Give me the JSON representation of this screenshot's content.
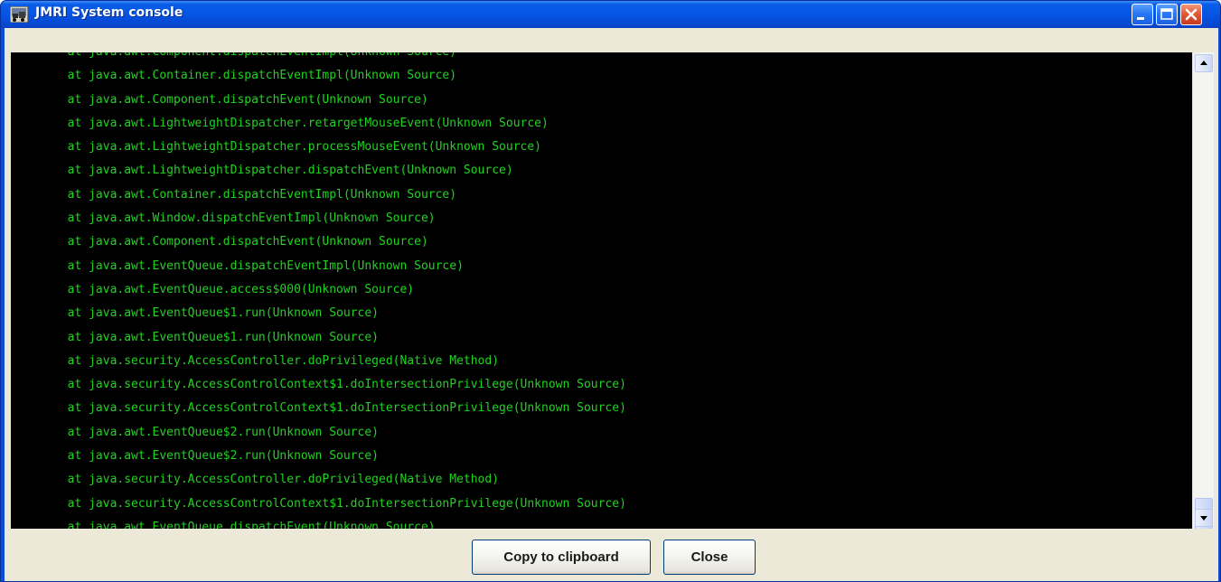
{
  "window": {
    "title": "JMRI System console",
    "icon": "jmri-app-icon"
  },
  "titlebar_buttons": {
    "minimize": "minimize-icon",
    "maximize": "maximize-icon",
    "close": "close-icon"
  },
  "colors": {
    "console_background": "#000000",
    "console_text": "#1fd41f",
    "titlebar": "#0554e3",
    "button_bar": "#ece9d8"
  },
  "console": {
    "lines": [
      "\tat java.awt.Component.dispatchEventImpl(Unknown Source)",
      "\tat java.awt.Container.dispatchEventImpl(Unknown Source)",
      "\tat java.awt.Component.dispatchEvent(Unknown Source)",
      "\tat java.awt.LightweightDispatcher.retargetMouseEvent(Unknown Source)",
      "\tat java.awt.LightweightDispatcher.processMouseEvent(Unknown Source)",
      "\tat java.awt.LightweightDispatcher.dispatchEvent(Unknown Source)",
      "\tat java.awt.Container.dispatchEventImpl(Unknown Source)",
      "\tat java.awt.Window.dispatchEventImpl(Unknown Source)",
      "\tat java.awt.Component.dispatchEvent(Unknown Source)",
      "\tat java.awt.EventQueue.dispatchEventImpl(Unknown Source)",
      "\tat java.awt.EventQueue.access$000(Unknown Source)",
      "\tat java.awt.EventQueue$1.run(Unknown Source)",
      "\tat java.awt.EventQueue$1.run(Unknown Source)",
      "\tat java.security.AccessController.doPrivileged(Native Method)",
      "\tat java.security.AccessControlContext$1.doIntersectionPrivilege(Unknown Source)",
      "\tat java.security.AccessControlContext$1.doIntersectionPrivilege(Unknown Source)",
      "\tat java.awt.EventQueue$2.run(Unknown Source)",
      "\tat java.awt.EventQueue$2.run(Unknown Source)",
      "\tat java.security.AccessController.doPrivileged(Native Method)",
      "\tat java.security.AccessControlContext$1.doIntersectionPrivilege(Unknown Source)",
      "\tat java.awt.EventQueue.dispatchEvent(Unknown Source)"
    ]
  },
  "scrollbar": {
    "up_icon": "scroll-up-arrow-icon",
    "down_icon": "scroll-down-arrow-icon",
    "position": 0.97
  },
  "buttons": {
    "copy_label": "Copy to clipboard",
    "close_label": "Close"
  }
}
